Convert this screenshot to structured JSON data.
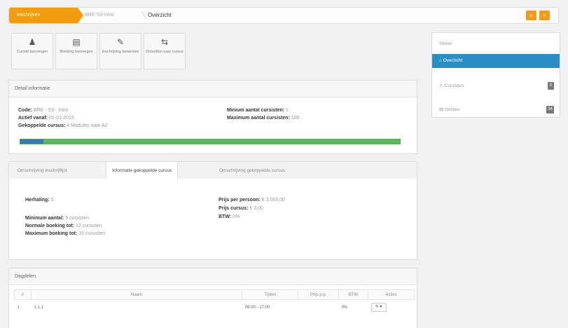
{
  "breadcrumb": {
    "items": [
      "Inschrijven",
      "BRE-S3-Intro",
      "Overzicht"
    ],
    "nav_prev": "«",
    "nav_next": "»"
  },
  "toolbar": [
    {
      "icon": "user-icon",
      "glyph": "♟",
      "label": "Cursist toevoegen"
    },
    {
      "icon": "document-icon",
      "glyph": "▤",
      "label": "Boeking toevoegen"
    },
    {
      "icon": "wrench-icon",
      "glyph": "✎",
      "label": "Inschrijving bewerken"
    },
    {
      "icon": "transfer-icon",
      "glyph": "⇆",
      "label": "Omzetten naar cursus"
    }
  ],
  "detail": {
    "title": "Detail informatie",
    "code_label": "Code:",
    "code_value": "BRE - S3 - Intro",
    "actief_label": "Actief vanaf:",
    "actief_value": "01-01-2015",
    "gekoppelde_label": "Gekoppelde cursus:",
    "gekoppelde_value": "4 Modules naar A2",
    "min_label": "Minium aantal cursisten:",
    "min_value": "1",
    "max_label": "Maximum aantal cursisten:",
    "max_value": "100",
    "progress_fraction": 0.06
  },
  "tabs": [
    "Omschrijving inschrijflijst",
    "Informatie gekoppelde cursus",
    "Omschrijving gekoppelde cursus"
  ],
  "info": {
    "herhaling_label": "Herhaling:",
    "herhaling_value": "0",
    "minimum_label": "Minimum aantal:",
    "minimum_value": "5 cursisten",
    "normale_label": "Normale boeking tot:",
    "normale_value": "12 cursisten",
    "maximum_label": "Maximum boeking tot:",
    "maximum_value": "16 cursisten",
    "prijs_persoon_label": "Prijs per persoon:",
    "prijs_persoon_value": "€ 3.000,00",
    "prijs_cursus_label": "Prijs cursus:",
    "prijs_cursus_value": "€ 3,00",
    "btw_label": "BTW:",
    "btw_value": "0%"
  },
  "dagdelen": {
    "title": "Dagdelen",
    "columns": [
      "#",
      "Naam",
      "Tijden",
      "Prijs p.p.",
      "BTW",
      "Acties"
    ],
    "rows": [
      {
        "num": "1",
        "naam": "1.1.1",
        "tijden": "06:00 - 17:00",
        "prijs": "",
        "btw": "0%"
      }
    ]
  },
  "sidebar": {
    "title": "Stelen",
    "items": [
      {
        "label": "Overzicht",
        "badge": ""
      },
      {
        "label": "Cursisten",
        "badge": "0"
      },
      {
        "label": "Notities",
        "badge": "34"
      }
    ]
  },
  "colors": {
    "accent": "#f39c12",
    "active": "#2a8fc5",
    "progress_blue": "#337ab7",
    "progress_green": "#5cb85c"
  }
}
